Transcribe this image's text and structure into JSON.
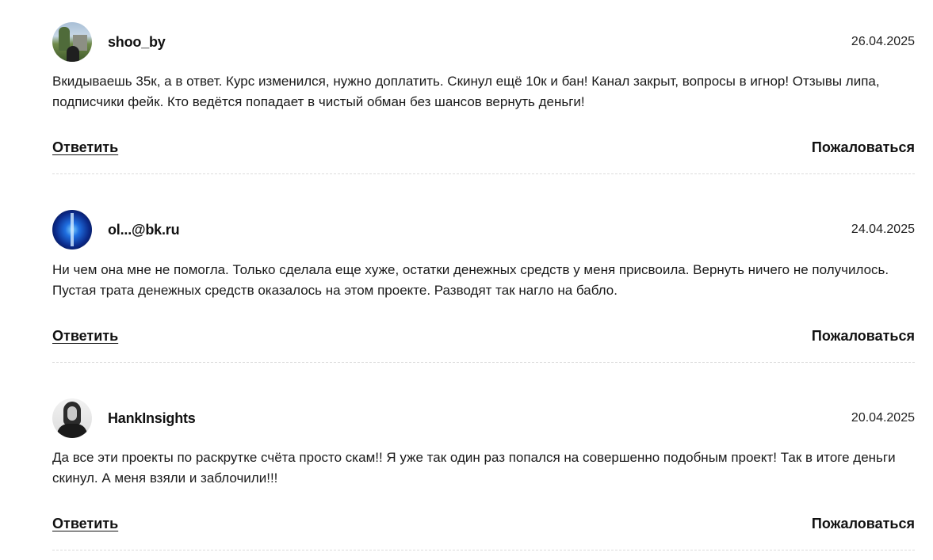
{
  "comments": [
    {
      "author": "shoo_by",
      "date": "26.04.2025",
      "avatar_icon": "landscape-photo-avatar",
      "text": "Вкидываешь 35к, а в ответ. Курс изменился, нужно доплатить. Скинул ещё 10к и бан! Канал закрыт, вопросы в игнор! Отзывы липа, подписчики фейк. Кто ведётся попадает в чистый обман без шансов вернуть деньги!",
      "reply_label": "Ответить",
      "report_label": "Пожаловаться"
    },
    {
      "author": "ol...@bk.ru",
      "date": "24.04.2025",
      "avatar_icon": "blue-glow-avatar",
      "text": "Ни чем она мне не помогла. Только сделала еще хуже, остатки денежных средств у меня присвоила. Вернуть ничего не получилось. Пустая трата денежных средств оказалось на этом проекте. Разводят так нагло на бабло.",
      "reply_label": "Ответить",
      "report_label": "Пожаловаться"
    },
    {
      "author": "HankInsights",
      "date": "20.04.2025",
      "avatar_icon": "portrait-photo-avatar",
      "text": "Да все эти проекты по раскрутке счёта просто скам!! Я уже так один раз попался на совершенно подобным проект! Так в итоге деньги скинул. А меня взяли и заблочили!!!",
      "reply_label": "Ответить",
      "report_label": "Пожаловаться"
    }
  ]
}
